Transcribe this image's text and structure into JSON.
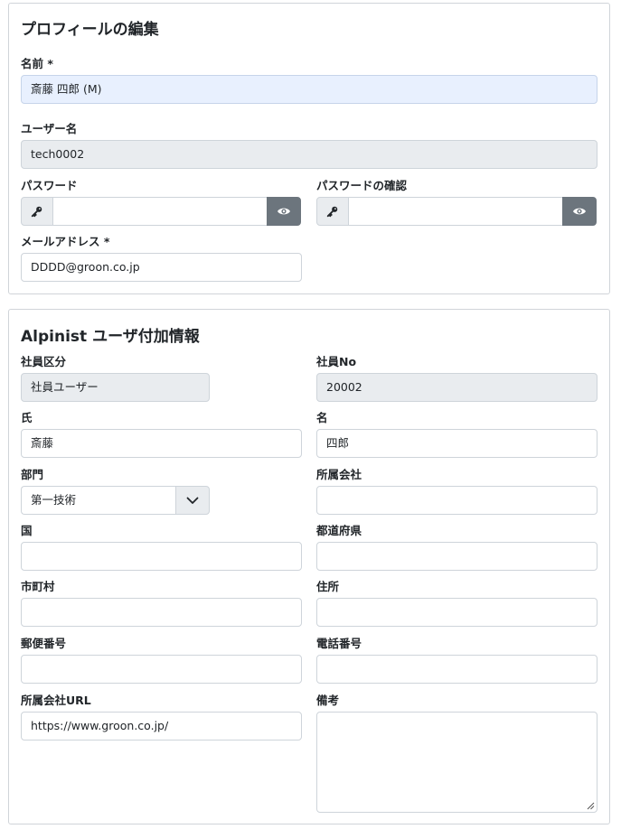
{
  "profile": {
    "title": "プロフィールの編集",
    "name_label": "名前 *",
    "name_value": "斎藤 四郎 (M)",
    "username_label": "ユーザー名",
    "username_value": "tech0002",
    "password_label": "パスワード",
    "password_confirm_label": "パスワードの確認",
    "email_label": "メールアドレス *",
    "email_value": "DDDD@groon.co.jp"
  },
  "extra": {
    "title": "Alpinist ユーザ付加情報",
    "employee_type_label": "社員区分",
    "employee_type_value": "社員ユーザー",
    "employee_no_label": "社員No",
    "employee_no_value": "20002",
    "last_name_label": "氏",
    "last_name_value": "斎藤",
    "first_name_label": "名",
    "first_name_value": "四郎",
    "department_label": "部門",
    "department_value": "第一技術",
    "company_label": "所属会社",
    "company_value": "",
    "country_label": "国",
    "country_value": "",
    "prefecture_label": "都道府県",
    "prefecture_value": "",
    "city_label": "市町村",
    "city_value": "",
    "address_label": "住所",
    "address_value": "",
    "postal_label": "郵便番号",
    "postal_value": "",
    "phone_label": "電話番号",
    "phone_value": "",
    "company_url_label": "所属会社URL",
    "company_url_value": "https://www.groon.co.jp/",
    "notes_label": "備考",
    "notes_value": ""
  },
  "colors": {
    "eye_button": "#6c757d",
    "readonly_bg": "#e9ecef",
    "focused_bg": "#e8f0fe"
  },
  "icons": {
    "password_key": "key-icon",
    "password_toggle": "eye-icon",
    "select_toggle": "chevron-down-icon",
    "resize": "resize-grip-icon"
  }
}
